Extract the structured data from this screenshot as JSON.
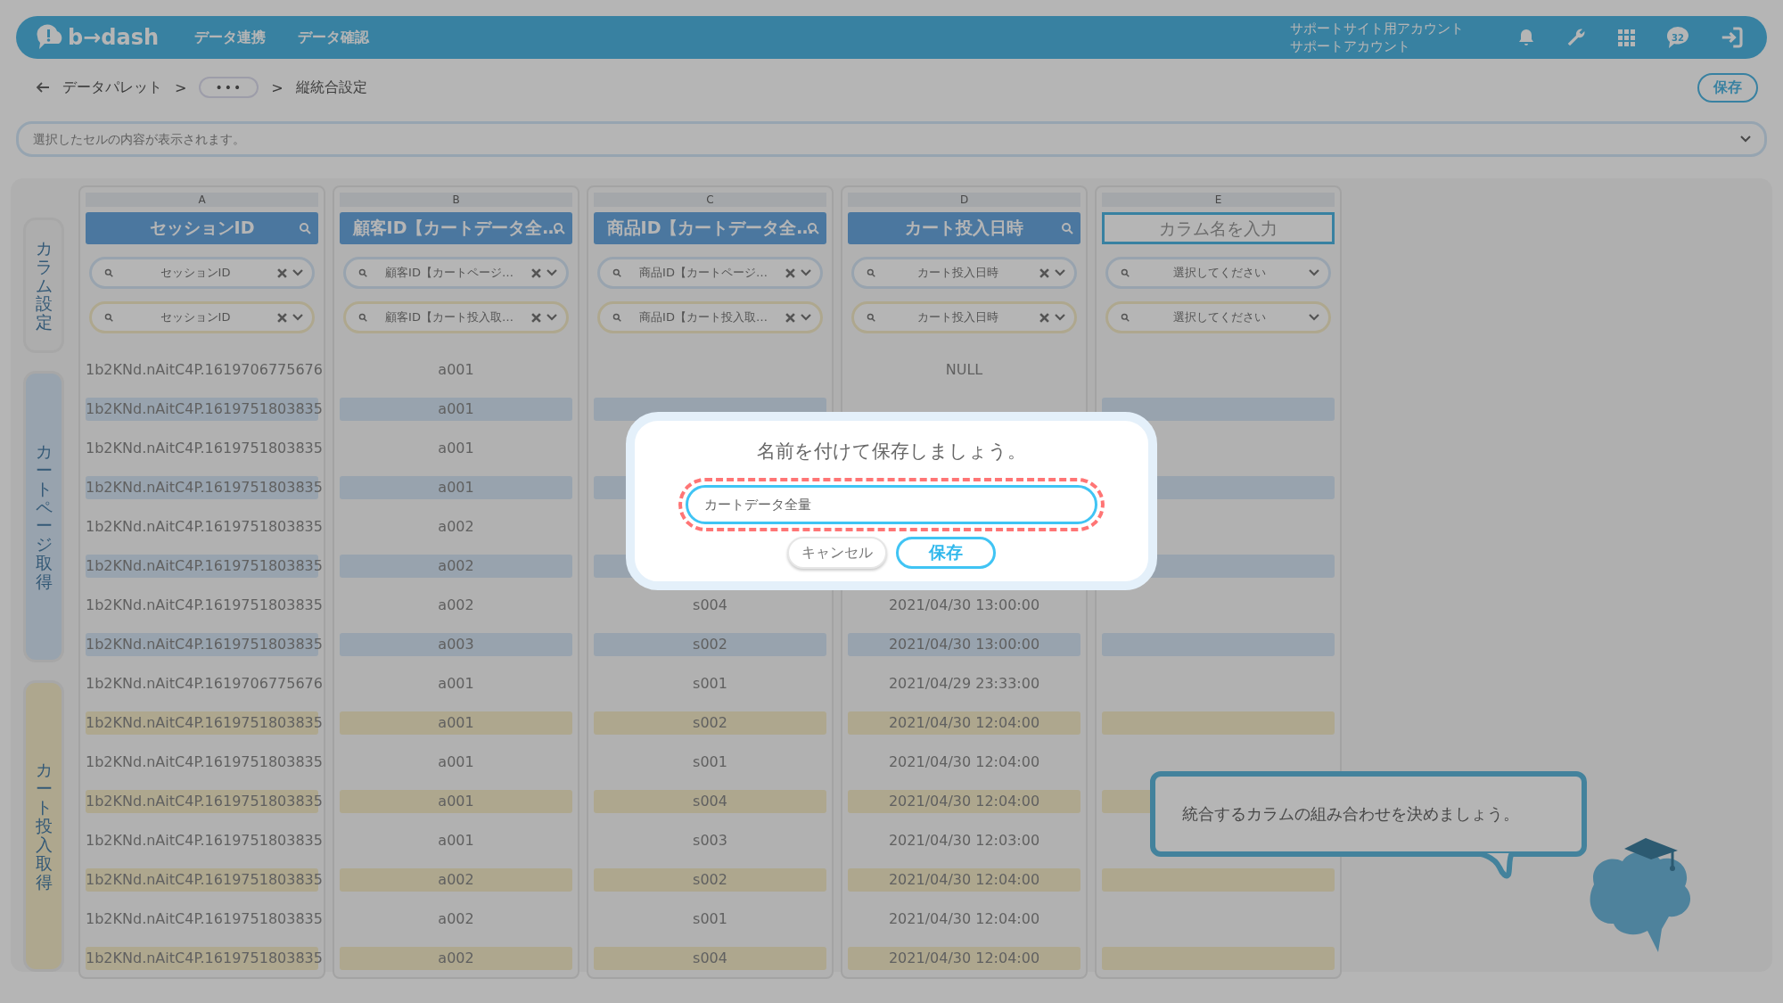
{
  "topbar": {
    "logo": "b→dash",
    "nav": [
      "データ連携",
      "データ確認"
    ],
    "account": [
      "サポートサイト用アカウント",
      "サポートアカウント"
    ],
    "chat_badge": "32"
  },
  "breadcrumb": {
    "items": [
      "データパレット",
      ">",
      "•••",
      ">",
      "縦統合設定"
    ],
    "save_button": "保存"
  },
  "cell_bar": {
    "placeholder": "選択したセルの内容が表示されます。"
  },
  "side_tabs": [
    {
      "label": "カラム設定",
      "kind": "settings"
    },
    {
      "label": "カートページ取得",
      "kind": "page"
    },
    {
      "label": "カート投入取得",
      "kind": "added"
    }
  ],
  "columns": [
    {
      "letter": "A",
      "kind": "named",
      "header": "セッションID",
      "filters": [
        {
          "value": "セッションID"
        },
        {
          "value": "セッションID"
        }
      ]
    },
    {
      "letter": "B",
      "kind": "named",
      "header": "顧客ID【カートデータ全…",
      "filters": [
        {
          "value": "顧客ID【カートページ…"
        },
        {
          "value": "顧客ID【カート投入取…"
        }
      ]
    },
    {
      "letter": "C",
      "kind": "named",
      "header": "商品ID【カートデータ全…",
      "filters": [
        {
          "value": "商品ID【カートページ…"
        },
        {
          "value": "商品ID【カート投入取…"
        }
      ]
    },
    {
      "letter": "D",
      "kind": "named",
      "header": "カート投入日時",
      "filters": [
        {
          "value": "カート投入日時"
        },
        {
          "value": "カート投入日時"
        }
      ]
    },
    {
      "letter": "E",
      "kind": "input",
      "placeholder": "カラム名を入力",
      "filters": [
        {
          "placeholder": "選択してください"
        },
        {
          "placeholder": "選択してください"
        }
      ]
    }
  ],
  "row_groups": [
    {
      "kind": "page",
      "rows": [
        {
          "highlighted": false,
          "session": "1b2KNd.nAitC4P.1619706775676",
          "customer": "a001",
          "added": "NULL"
        },
        {
          "highlighted": true,
          "session": "1b2KNd.nAitC4P.1619751803835",
          "customer": "a001"
        },
        {
          "highlighted": false,
          "session": "1b2KNd.nAitC4P.1619751803835",
          "customer": "a001"
        },
        {
          "highlighted": true,
          "session": "1b2KNd.nAitC4P.1619751803835",
          "customer": "a001"
        },
        {
          "highlighted": false,
          "session": "1b2KNd.nAitC4P.1619751803835",
          "customer": "a002"
        },
        {
          "highlighted": true,
          "session": "1b2KNd.nAitC4P.1619751803835",
          "customer": "a002"
        },
        {
          "highlighted": false,
          "session": "1b2KNd.nAitC4P.1619751803835",
          "customer": "a002",
          "product": "s004",
          "added": "2021/04/30 13:00:00"
        },
        {
          "highlighted": true,
          "session": "1b2KNd.nAitC4P.1619751803835",
          "customer": "a003",
          "product": "s002",
          "added": "2021/04/30 13:00:00"
        }
      ]
    },
    {
      "kind": "added",
      "rows": [
        {
          "highlighted": false,
          "session": "1b2KNd.nAitC4P.1619706775676",
          "customer": "a001",
          "product": "s001",
          "added": "2021/04/29 23:33:00"
        },
        {
          "highlighted": true,
          "session": "1b2KNd.nAitC4P.1619751803835",
          "customer": "a001",
          "product": "s002",
          "added": "2021/04/30 12:04:00"
        },
        {
          "highlighted": false,
          "session": "1b2KNd.nAitC4P.1619751803835",
          "customer": "a001",
          "product": "s001",
          "added": "2021/04/30 12:04:00"
        },
        {
          "highlighted": true,
          "session": "1b2KNd.nAitC4P.1619751803835",
          "customer": "a001",
          "product": "s004",
          "added": "2021/04/30 12:04:00"
        },
        {
          "highlighted": false,
          "session": "1b2KNd.nAitC4P.1619751803835",
          "customer": "a001",
          "product": "s003",
          "added": "2021/04/30 12:03:00"
        },
        {
          "highlighted": true,
          "session": "1b2KNd.nAitC4P.1619751803835",
          "customer": "a002",
          "product": "s002",
          "added": "2021/04/30 12:04:00"
        },
        {
          "highlighted": false,
          "session": "1b2KNd.nAitC4P.1619751803835",
          "customer": "a002",
          "product": "s001",
          "added": "2021/04/30 12:04:00"
        },
        {
          "highlighted": true,
          "session": "1b2KNd.nAitC4P.1619751803835",
          "customer": "a002",
          "product": "s004",
          "added": "2021/04/30 12:04:00"
        }
      ]
    }
  ],
  "hint_bubble": {
    "text": "統合するカラムの組み合わせを決めましょう。"
  },
  "dialog": {
    "title": "名前を付けて保存しましょう。",
    "input": {
      "value": "カートデータ全量",
      "highlighted": true
    },
    "buttons": [
      {
        "label": "キャンセル",
        "kind": "secondary"
      },
      {
        "label": "保存",
        "kind": "primary"
      }
    ]
  }
}
